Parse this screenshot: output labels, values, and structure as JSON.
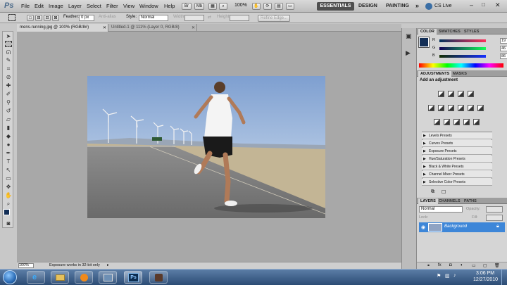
{
  "app": {
    "logo": "Ps"
  },
  "menu": [
    "File",
    "Edit",
    "Image",
    "Layer",
    "Select",
    "Filter",
    "View",
    "Window",
    "Help"
  ],
  "menu_right": {
    "zoom": "100%"
  },
  "workspaces": {
    "active": "ESSENTIALS",
    "design": "DESIGN",
    "painting": "PAINTING",
    "more": "»",
    "cslive": "CS Live"
  },
  "options": {
    "feather_label": "Feather:",
    "feather_value": "0 px",
    "anti_alias": "Anti-alias",
    "style_label": "Style:",
    "style_value": "Normal",
    "width_label": "Width:",
    "height_label": "Height:",
    "refine": "Refine Edge..."
  },
  "tabs": [
    {
      "label": "mens-running.jpg @ 100% (RGB/8#)"
    },
    {
      "label": "Untitled-1 @ 111% (Layer 0, RGB/8)"
    }
  ],
  "status": {
    "zoom": "100%",
    "info": "Exposure works in 32-bit only"
  },
  "color_panel": {
    "tabs": [
      "COLOR",
      "SWATCHES",
      "STYLES"
    ],
    "rows": [
      {
        "label": "R",
        "value": "19",
        "gradient": "#ff0000"
      },
      {
        "label": "G",
        "value": "46",
        "gradient": "#00ff00"
      },
      {
        "label": "B",
        "value": "86",
        "gradient": "#0000ff"
      }
    ],
    "foreground": "#132e56"
  },
  "adjust_panel": {
    "tabs": [
      "ADJUSTMENTS",
      "MASKS"
    ],
    "title": "Add an adjustment",
    "presets": [
      "Levels Presets",
      "Curves Presets",
      "Exposure Presets",
      "Hue/Saturation Presets",
      "Black & White Presets",
      "Channel Mixer Presets",
      "Selective Color Presets"
    ]
  },
  "layers_panel": {
    "tabs": [
      "LAYERS",
      "CHANNELS",
      "PATHS"
    ],
    "blend": "Normal",
    "opacity_label": "Opacity:",
    "fill_label": "Fill:",
    "lock_label": "Lock:",
    "layer_name": "Background"
  },
  "taskbar": {
    "time": "3:06 PM",
    "date": "12/27/2010",
    "ps_label": "Ps"
  },
  "colors": {
    "accent": "#3a7bd5",
    "taskbar": "#2c4c75",
    "selected_layer": "#3d86d8"
  }
}
